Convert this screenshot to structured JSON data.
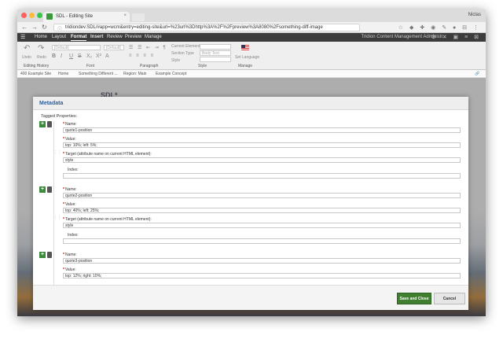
{
  "browser": {
    "tab_title": "SDL - Editing Site",
    "user_name": "Niclas",
    "url": "tridiondev.SDL/#app=wcm&entry=editing-site&url=%23url%3Dhttp%3A%2F%2Fpreview%3A8080%2Fsomething-diff-image",
    "colors": {
      "close": "#fc615d",
      "min": "#fdbc40",
      "max": "#34c84a"
    }
  },
  "menubar": {
    "items": [
      "Home",
      "Layout",
      "Format",
      "Insert",
      "Review",
      "Preview",
      "Manage"
    ],
    "active": "Format",
    "right_text": "Tridion Content Management Administr..."
  },
  "ribbon": {
    "undo": "Undo",
    "redo": "Redo",
    "font_select": "[Default]",
    "size_select": "[Default]",
    "current_element": "Current Element",
    "section_type": "Section Type",
    "section_type_value": "Body Text",
    "style": "Style",
    "set_language": "Set Language",
    "groups": [
      "Editing History",
      "Font",
      "Paragraph",
      "Style",
      "Manage"
    ],
    "format_buttons": [
      "B",
      "I",
      "U",
      "S",
      "X₂",
      "X²"
    ]
  },
  "breadcrumb": [
    "400 Example Site",
    "Home",
    "Something Different ...",
    "Region: Main",
    "Example Concept"
  ],
  "preview_logo": "SDL*",
  "dialog": {
    "title": "Metadata",
    "tagged_label": "Tagged Properties:",
    "entries": [
      {
        "name_label": "Name:",
        "name_value": "quote1-position",
        "value_label": "Value:",
        "value_value": "top: 10%; left: 5%;",
        "target_label": "Target (attribute name on current HTML element):",
        "target_value": "style",
        "index_label": "Index:",
        "index_value": ""
      },
      {
        "name_label": "Name:",
        "name_value": "quote2-position",
        "value_label": "Value:",
        "value_value": "top: 40%; left: 25%;",
        "target_label": "Target (attribute name on current HTML element):",
        "target_value": "style",
        "index_label": "Index:",
        "index_value": ""
      },
      {
        "name_label": "Name:",
        "name_value": "quote3-position",
        "value_label": "Value:",
        "value_value": "top: 12%; right: 10%;",
        "target_label": "Target (attribute name on current HTML element):",
        "target_value": "style",
        "index_label": "Index:",
        "index_value": ""
      }
    ],
    "save_close": "Save and Close",
    "cancel": "Cancel"
  }
}
